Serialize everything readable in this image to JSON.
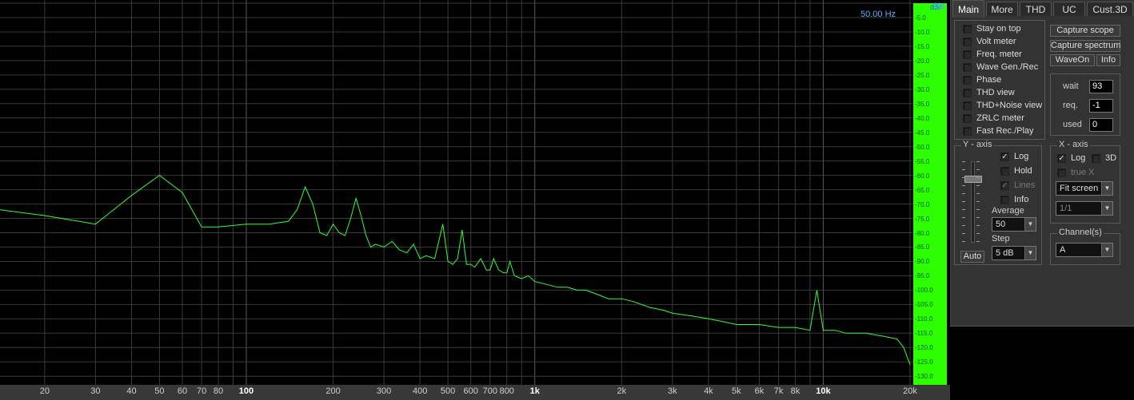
{
  "window": {
    "freq_readout": "50.00 Hz",
    "y_unit": "dBr",
    "x_unit": "Hz"
  },
  "colors": {
    "trace": "#33ff33",
    "scale_bg": "#2dff00",
    "grid": "#3a3a3a"
  },
  "tabs": [
    "Main",
    "More",
    "THD",
    "UC",
    "Cust.3D"
  ],
  "active_tab": "Main",
  "options": {
    "items": [
      {
        "label": "Stay on top",
        "checked": false
      },
      {
        "label": "Volt meter",
        "checked": false
      },
      {
        "label": "Freq. meter",
        "checked": false
      },
      {
        "label": "Wave Gen./Rec",
        "checked": false
      },
      {
        "label": "Phase",
        "checked": false
      },
      {
        "label": "THD view",
        "checked": false
      },
      {
        "label": "THD+Noise view",
        "checked": false
      },
      {
        "label": "ZRLC meter",
        "checked": false
      },
      {
        "label": "Fast Rec./Play",
        "checked": false
      }
    ]
  },
  "buttons": {
    "capture_scope": "Capture scope",
    "capture_spectrum": "Capture spectrum",
    "waveon": "WaveOn",
    "info": "Info",
    "auto": "Auto"
  },
  "timing": {
    "wait_label": "wait",
    "wait_value": "93",
    "req_label": "req.",
    "req_value": "-1",
    "used_label": "used",
    "used_value": "0"
  },
  "yaxis": {
    "title": "Y - axis",
    "log_label": "Log",
    "log_checked": true,
    "hold_label": "Hold",
    "hold_checked": false,
    "lines_label": "Lines",
    "lines_checked": true,
    "info_label": "Info",
    "info_checked": false,
    "average_label": "Average",
    "average_value": "50",
    "step_label": "Step",
    "step_value": "5 dB"
  },
  "xaxis": {
    "title": "X - axis",
    "log_label": "Log",
    "log_checked": true,
    "d3_label": "3D",
    "d3_checked": false,
    "truex_label": "true X",
    "truex_checked": false,
    "scale_value": "Fit screen",
    "ratio_value": "1/1"
  },
  "channels": {
    "title": "Channel(s)",
    "value": "A"
  },
  "chart_data": {
    "type": "line",
    "x_scale": "log",
    "xlim": [
      14,
      20000
    ],
    "ylim": [
      0,
      -133
    ],
    "grid": true,
    "x_ticks": [
      "20",
      "30",
      "40",
      "50",
      "60",
      "70",
      "80",
      "100",
      "200",
      "300",
      "400",
      "500",
      "600",
      "700",
      "800",
      "1k",
      "2k",
      "3k",
      "4k",
      "5k",
      "6k",
      "7k",
      "8k",
      "10k",
      "20k"
    ],
    "x_tick_values": [
      20,
      30,
      40,
      50,
      60,
      70,
      80,
      100,
      200,
      300,
      400,
      500,
      600,
      700,
      800,
      1000,
      2000,
      3000,
      4000,
      5000,
      6000,
      7000,
      8000,
      10000,
      20000
    ],
    "x_major_ticks": [
      "100",
      "1k",
      "10k"
    ],
    "y_ticks": [
      "-5.0",
      "-10.0",
      "-15.0",
      "-20.0",
      "-25.0",
      "-30.0",
      "-35.0",
      "-40.0",
      "-45.0",
      "-50.0",
      "-55.0",
      "-60.0",
      "-65.0",
      "-70.0",
      "-75.0",
      "-80.0",
      "-85.0",
      "-90.0",
      "-95.0",
      "-100.0",
      "-105.0",
      "-110.0",
      "-115.0",
      "-120.0",
      "-125.0",
      "-130.0"
    ],
    "series": [
      {
        "x": [
          14,
          20,
          30,
          40,
          50,
          60,
          70,
          80,
          100,
          120,
          140,
          150,
          160,
          170,
          180,
          190,
          200,
          210,
          220,
          230,
          240,
          250,
          260,
          270,
          280,
          300,
          320,
          340,
          360,
          380,
          400,
          420,
          450,
          480,
          500,
          520,
          540,
          560,
          580,
          600,
          620,
          650,
          680,
          700,
          720,
          750,
          780,
          800,
          820,
          850,
          900,
          950,
          1000,
          1100,
          1200,
          1300,
          1400,
          1500,
          1600,
          1700,
          1800,
          2000,
          2200,
          2500,
          2800,
          3000,
          3500,
          4000,
          4500,
          5000,
          5500,
          6000,
          7000,
          8000,
          9000,
          9500,
          10000,
          11000,
          12000,
          14000,
          16000,
          18000,
          19000,
          20000
        ],
        "y": [
          -72,
          -74,
          -77,
          -67,
          -60,
          -66,
          -78,
          -78,
          -77,
          -77,
          -76,
          -72,
          -64,
          -70,
          -80,
          -81,
          -77,
          -80,
          -81,
          -75,
          -68,
          -74,
          -81,
          -85,
          -84,
          -85,
          -83,
          -86,
          -87,
          -84,
          -89,
          -88,
          -89,
          -77,
          -90,
          -91,
          -89,
          -79,
          -91,
          -91,
          -92,
          -89,
          -93,
          -93,
          -89,
          -93,
          -94,
          -94,
          -90,
          -95,
          -96,
          -95,
          -97,
          -98,
          -99,
          -99,
          -100,
          -100,
          -101,
          -102,
          -103,
          -103,
          -104,
          -106,
          -107,
          -108,
          -109,
          -110,
          -111,
          -112,
          -112,
          -112,
          -113,
          -113,
          -114,
          -100,
          -114,
          -114,
          -115,
          -115,
          -116,
          -117,
          -120,
          -126
        ]
      }
    ]
  }
}
